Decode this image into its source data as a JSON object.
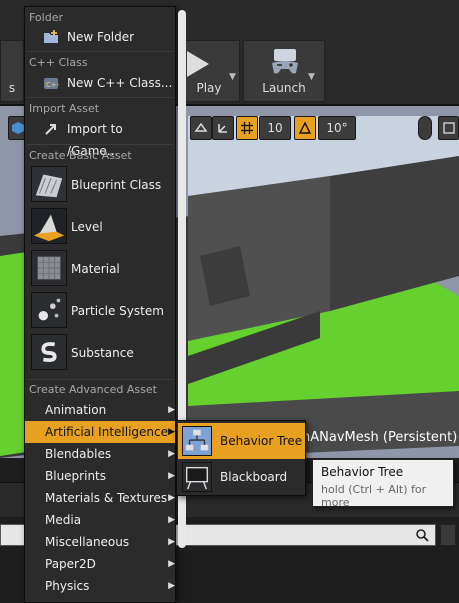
{
  "toolbar": {
    "left_button_label": "s",
    "play_label": "Play",
    "launch_label": "Launch"
  },
  "viewport": {
    "snap_angle": "10",
    "rotate_angle": "10°",
    "level_title": "nANavMesh (Persistent)"
  },
  "menu": {
    "sections": {
      "folder": "Folder",
      "cpp_class": "C++ Class",
      "import_asset": "Import Asset",
      "create_basic_asset": "Create Basic Asset",
      "create_advanced_asset": "Create Advanced Asset"
    },
    "new_folder": "New Folder",
    "new_cpp_class": "New C++ Class...",
    "import_to_game": "Import to /Game...",
    "basic_assets": [
      "Blueprint Class",
      "Level",
      "Material",
      "Particle System",
      "Substance"
    ],
    "advanced_assets": [
      "Animation",
      "Artificial Intelligence",
      "Blendables",
      "Blueprints",
      "Materials & Textures",
      "Media",
      "Miscellaneous",
      "Paper2D",
      "Physics"
    ],
    "active_advanced": "Artificial Intelligence"
  },
  "submenu": {
    "items": [
      "Behavior Tree",
      "Blackboard"
    ],
    "active": "Behavior Tree"
  },
  "tooltip": {
    "title": "Behavior Tree",
    "hint": "hold (Ctrl + Alt) for more"
  },
  "colors": {
    "accent": "#e8a020",
    "menu_bg": "#2b2b2b",
    "floor_green": "#66d12e",
    "wall_dark": "#3a3a3a"
  }
}
